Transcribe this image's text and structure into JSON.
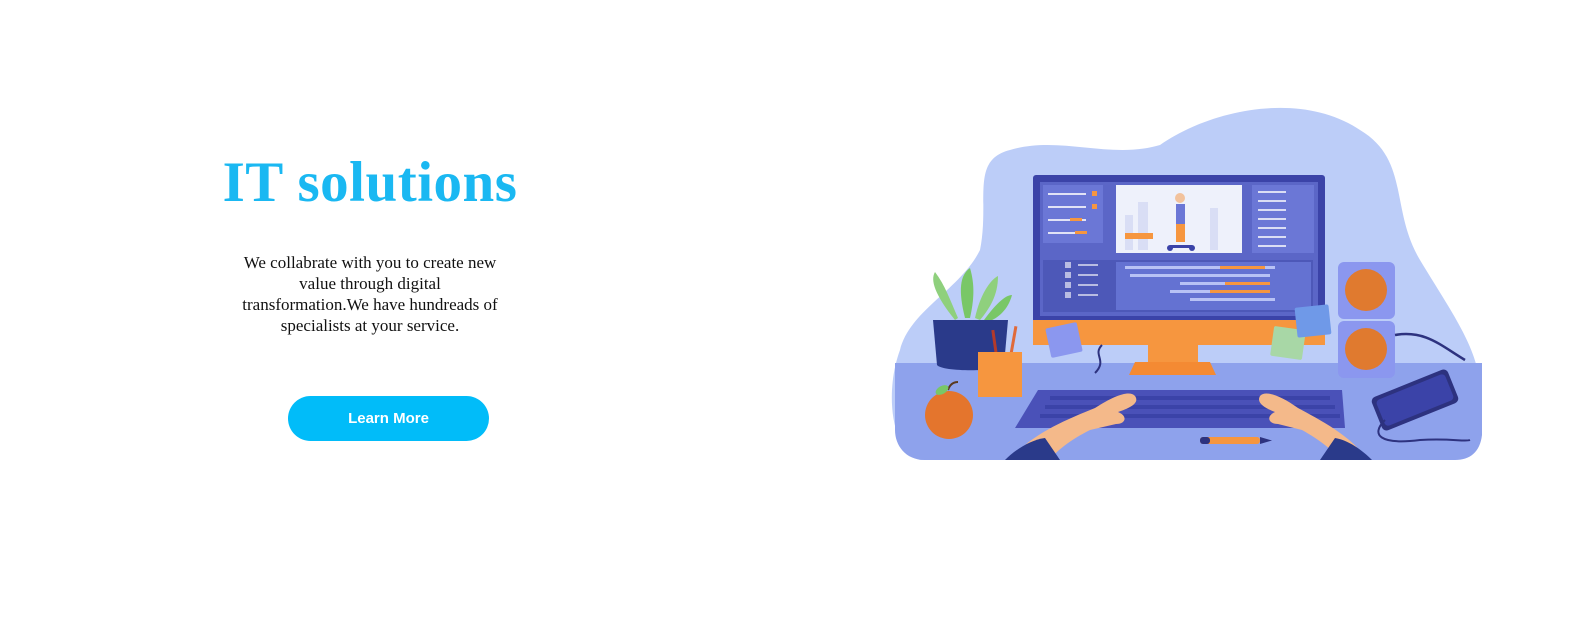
{
  "hero": {
    "title": "IT solutions",
    "description": "We collabrate with you to create new value through digital transformation.We have hundreads of specialists at your service.",
    "button_label": "Learn More"
  },
  "colors": {
    "accent": "#01bcf9",
    "title": "#1ab8f2",
    "blob": "#bccdf8",
    "desk": "#8ea2ec",
    "monitor_frame": "#3b43a8",
    "orange": "#f6963f"
  },
  "illustration": {
    "icons": [
      "monitor-icon",
      "keyboard-icon",
      "plant-icon",
      "pencil-cup-icon",
      "apple-icon",
      "speaker-icon",
      "tablet-icon",
      "hands-icon",
      "sticky-note-icon",
      "pencil-icon"
    ]
  }
}
